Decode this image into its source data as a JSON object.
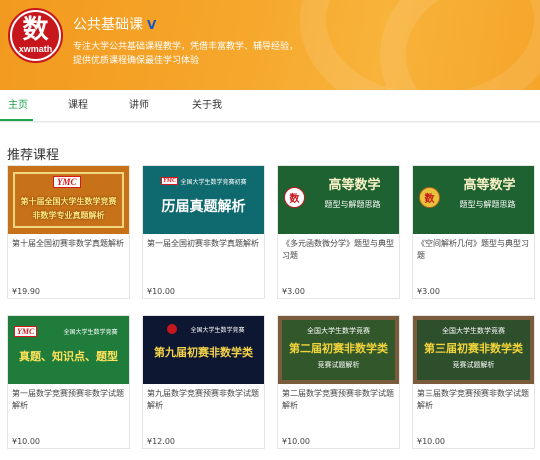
{
  "profile": {
    "logo_glyph": "数",
    "logo_word": "xwmath",
    "title": "公共基础课",
    "verify_icon": "V",
    "description": "专注大学公共基础课程教学，凭借丰富教学、辅导经验，提供优质课程确保最佳学习体验"
  },
  "nav": {
    "tabs": [
      "主页",
      "课程",
      "讲师",
      "关于我"
    ],
    "active_index": 0
  },
  "section": {
    "title": "推荐课程"
  },
  "thumb_text": {
    "ymc": "YMC",
    "c1_line1": "第十届全国大学生数学竞赛",
    "c1_line2": "非数学专业真题解析",
    "teal_header": "全国大学生数学竞赛初赛",
    "c2_main": "历届真题解析",
    "gs_title": "高等数学",
    "gs_sub": "题型与解题思路",
    "gs_logo": "数",
    "c5_header": "全国大学生数学竞赛",
    "c5_main": "真题、知识点、题型",
    "c6_header": "全国大学生数学竞赛",
    "c6_main": "第九届初赛非数学类",
    "c7_header": "全国大学生数学竞赛",
    "c7_main": "第二届初赛非数学类",
    "c7_sub": "竞赛试题解析",
    "c8_header": "全国大学生数学竞赛",
    "c8_main": "第三届初赛非数学类",
    "c8_sub": "竞赛试题解析"
  },
  "courses": [
    {
      "title": "第十届全国初赛非数学真题解析",
      "price": "¥19.90"
    },
    {
      "title": "第一届全国初赛非数学真题解析",
      "price": "¥10.00"
    },
    {
      "title": "《多元函数微分学》题型与典型习题",
      "price": "¥3.00"
    },
    {
      "title": "《空间解析几何》题型与典型习题",
      "price": "¥3.00"
    },
    {
      "title": "第一届数学竞赛预赛非数学试题解析",
      "price": "¥10.00"
    },
    {
      "title": "第九届数学竞赛预赛非数学试题解析",
      "price": "¥12.00"
    },
    {
      "title": "第二届数学竞赛预赛非数学试题解析",
      "price": "¥10.00"
    },
    {
      "title": "第三届数学竞赛预赛非数学试题解析",
      "price": "¥10.00"
    }
  ],
  "colors": {
    "accent": "#1da34c",
    "banner": "#f6a72c",
    "brand_red": "#c8161d"
  }
}
